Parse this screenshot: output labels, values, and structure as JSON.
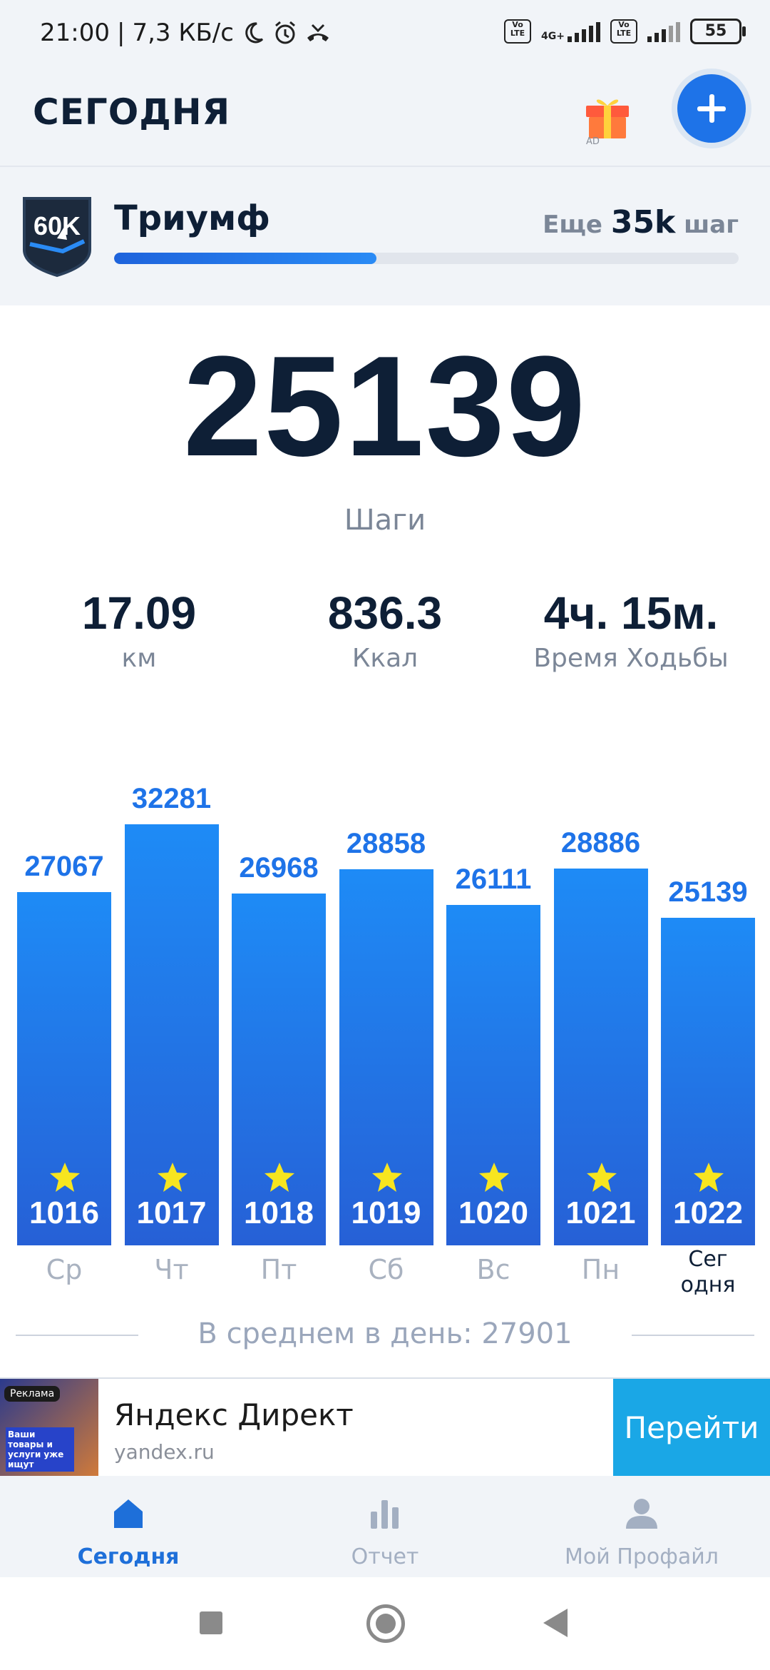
{
  "status_bar": {
    "time": "21:00",
    "speed": "7,3 КБ/с",
    "network_label": "4G+",
    "volte_label": "Vo LTE",
    "battery": "55"
  },
  "header": {
    "title": "СЕГОДНЯ",
    "gift_icon_label": "AD"
  },
  "achievement": {
    "badge_text": "60K",
    "name": "Триумф",
    "remain_prefix": "Еще",
    "remain_value": "35k",
    "remain_suffix": "шаг",
    "progress_fraction": 0.42
  },
  "summary": {
    "steps": "25139",
    "steps_label": "Шаги",
    "distance_value": "17.09",
    "distance_unit": "км",
    "calories_value": "836.3",
    "calories_unit": "Ккал",
    "time_value": "4ч. 15м.",
    "time_label": "Время Ходьбы"
  },
  "chart_data": {
    "type": "bar",
    "categories": [
      "Ср",
      "Чт",
      "Пт",
      "Сб",
      "Вс",
      "Пн",
      "Сег одня"
    ],
    "values": [
      27067,
      32281,
      26968,
      28858,
      26111,
      28886,
      25139
    ],
    "streak_numbers": [
      "1016",
      "1017",
      "1018",
      "1019",
      "1020",
      "1021",
      "1022"
    ],
    "today_label_line1": "Сег",
    "today_label_line2": "одня",
    "average_text": "В среднем в день: 27901",
    "ylim": [
      0,
      32281
    ],
    "colors": {
      "bar_top": "#1e8bf6",
      "bar_bottom": "#2660d6",
      "value_text": "#1e73e8",
      "star": "#f7e51f"
    }
  },
  "ad": {
    "tag": "Реклама",
    "image_text": "Ваши товары и услуги уже ищут",
    "title": "Яндекс Директ",
    "domain": "yandex.ru",
    "button": "Перейти"
  },
  "bottom_nav": {
    "items": [
      {
        "label": "Сегодня",
        "icon": "home-icon",
        "active": true
      },
      {
        "label": "Отчет",
        "icon": "bar-chart-icon",
        "active": false
      },
      {
        "label": "Мой Профайл",
        "icon": "profile-icon",
        "active": false
      }
    ]
  },
  "colors": {
    "accent": "#1e73e8",
    "text_dark": "#0e1f36",
    "text_muted": "#7b8697",
    "ad_button": "#1aa7e6"
  }
}
